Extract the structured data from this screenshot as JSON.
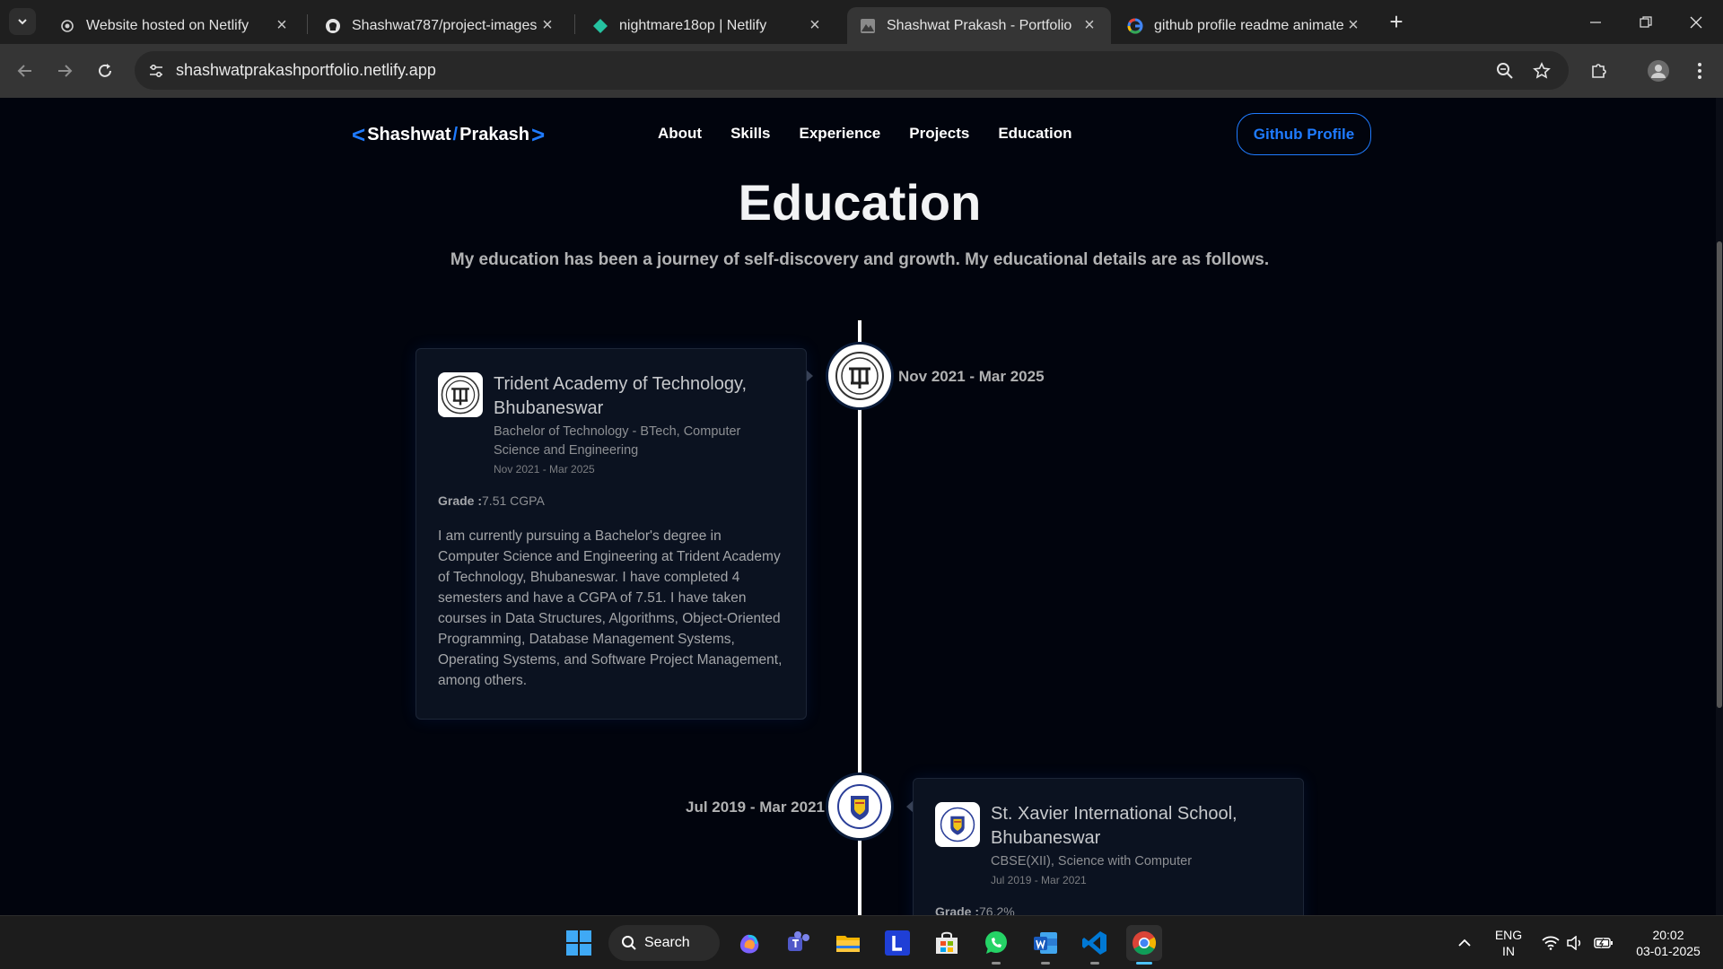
{
  "browser": {
    "tabs": [
      {
        "title": "Website hosted on Netlify",
        "icon": "netlify-swirl-icon",
        "active": false
      },
      {
        "title": "Shashwat787/project-images",
        "icon": "github-icon",
        "active": false
      },
      {
        "title": "nightmare18op | Netlify",
        "icon": "netlify-diamond-icon",
        "active": false
      },
      {
        "title": "Shashwat Prakash - Portfolio",
        "icon": "portfolio-favicon",
        "active": true
      },
      {
        "title": "github profile readme animated",
        "icon": "google-icon",
        "active": false
      }
    ],
    "url": "shashwatprakashportfolio.netlify.app"
  },
  "site": {
    "logo": {
      "first": "Shashwat",
      "slash": "/",
      "last": "Prakash",
      "left_bracket": "<",
      "right_bracket": ">"
    },
    "menu": [
      "About",
      "Skills",
      "Experience",
      "Projects",
      "Education"
    ],
    "github_button": "Github Profile",
    "accent": "#1f7bff"
  },
  "section": {
    "title": "Education",
    "description": "My education has been a journey of self-discovery and growth. My educational details are as follows."
  },
  "education": [
    {
      "school": "Trident Academy of Technology, Bhubaneswar",
      "degree": "Bachelor of Technology - BTech, Computer Science and Engineering",
      "date": "Nov 2021 - Mar 2025",
      "grade_label": "Grade :",
      "grade": "7.51 CGPA",
      "description": "I am currently pursuing a Bachelor's degree in Computer Science and Engineering at Trident Academy of Technology, Bhubaneswar. I have completed 4 semesters and have a CGPA of 7.51. I have taken courses in Data Structures, Algorithms, Object-Oriented Programming, Database Management Systems, Operating Systems, and Software Project Management, among others."
    },
    {
      "school": "St. Xavier International School, Bhubaneswar",
      "degree": "CBSE(XII), Science with Computer",
      "date": "Jul 2019 - Mar 2021",
      "grade_label": "Grade :",
      "grade": "76.2%"
    }
  ],
  "taskbar": {
    "search_label": "Search",
    "lang_top": "ENG",
    "lang_bottom": "IN",
    "time": "20:02",
    "date": "03-01-2025",
    "apps": [
      "copilot-icon",
      "teams-icon",
      "file-explorer-icon",
      "l-app-icon",
      "microsoft-store-icon",
      "whatsapp-icon",
      "word-icon",
      "vscode-icon",
      "chrome-icon"
    ]
  }
}
